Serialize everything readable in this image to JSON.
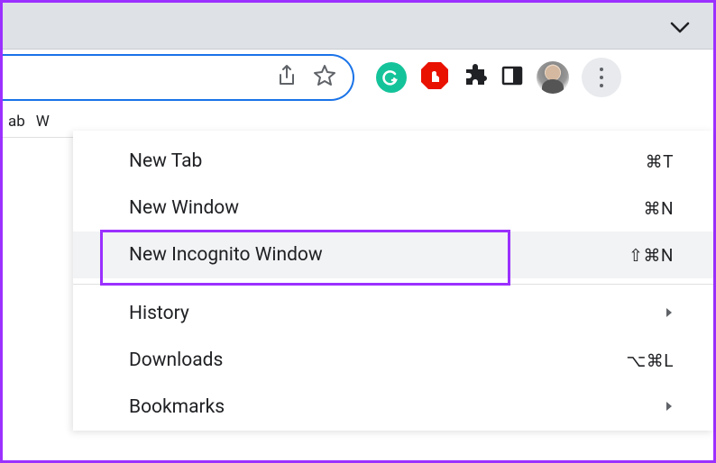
{
  "bookmarkStrip": {
    "item1": "ab",
    "item2": "W"
  },
  "menu": {
    "items": [
      {
        "label": "New Tab",
        "shortcut": "⌘T",
        "hasArrow": false,
        "hovered": false
      },
      {
        "label": "New Window",
        "shortcut": "⌘N",
        "hasArrow": false,
        "hovered": false
      },
      {
        "label": "New Incognito Window",
        "shortcut": "⇧⌘N",
        "hasArrow": false,
        "hovered": true
      },
      {
        "separator": true
      },
      {
        "label": "History",
        "shortcut": "",
        "hasArrow": true,
        "hovered": false
      },
      {
        "label": "Downloads",
        "shortcut": "⌥⌘L",
        "hasArrow": false,
        "hovered": false
      },
      {
        "label": "Bookmarks",
        "shortcut": "",
        "hasArrow": true,
        "hovered": false
      }
    ]
  },
  "colors": {
    "highlight": "#9b30ff",
    "addressBarBorder": "#1a73e8"
  }
}
